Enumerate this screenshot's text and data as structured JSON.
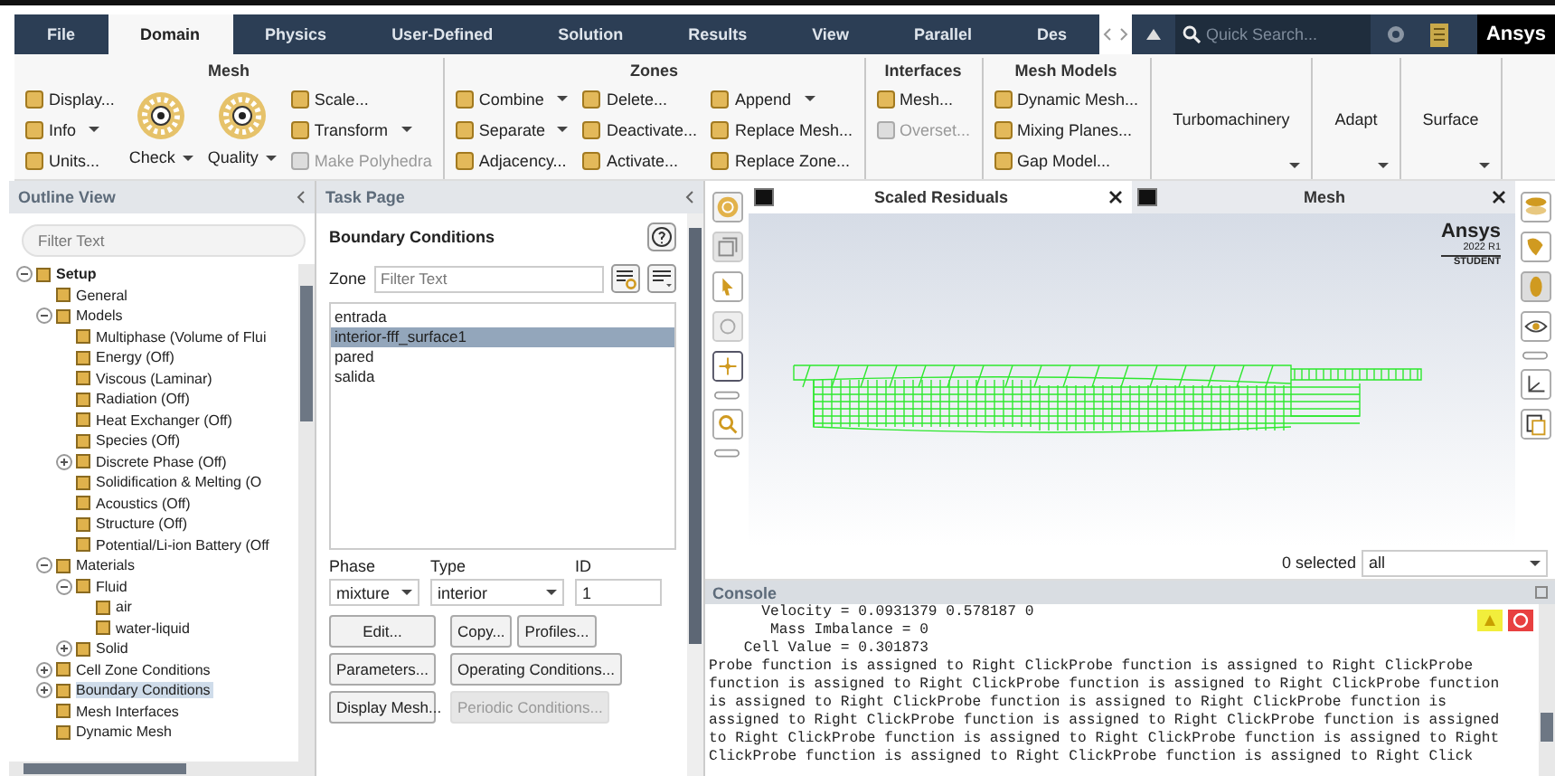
{
  "menu_tabs": [
    {
      "label": "File",
      "selected": false
    },
    {
      "label": "Domain",
      "selected": true
    },
    {
      "label": "Physics",
      "selected": false
    },
    {
      "label": "User-Defined",
      "selected": false
    },
    {
      "label": "Solution",
      "selected": false
    },
    {
      "label": "Results",
      "selected": false
    },
    {
      "label": "View",
      "selected": false
    },
    {
      "label": "Parallel",
      "selected": false
    },
    {
      "label": "Des",
      "selected": false
    }
  ],
  "search": {
    "placeholder": "Quick Search..."
  },
  "brand": "Ansys",
  "ribbon": [
    {
      "kind": "panel",
      "title": "Mesh",
      "columns": [
        [
          {
            "kind": "small",
            "label": "Display...",
            "dropdown": false,
            "disabled": false
          },
          {
            "kind": "small",
            "label": "Info",
            "dropdown": true,
            "disabled": false
          },
          {
            "kind": "small",
            "label": "Units...",
            "dropdown": false,
            "disabled": false
          }
        ],
        [
          {
            "kind": "large",
            "label": "Check",
            "dropdown": true,
            "disabled": false
          }
        ],
        [
          {
            "kind": "large",
            "label": "Quality",
            "dropdown": true,
            "disabled": false
          }
        ],
        [
          {
            "kind": "small",
            "label": "Scale...",
            "dropdown": false,
            "disabled": false
          },
          {
            "kind": "small",
            "label": "Transform",
            "dropdown": true,
            "disabled": false
          },
          {
            "kind": "small",
            "label": "Make Polyhedra",
            "dropdown": false,
            "disabled": true
          }
        ]
      ]
    },
    {
      "kind": "panel",
      "title": "Zones",
      "columns": [
        [
          {
            "kind": "small",
            "label": "Combine",
            "dropdown": true,
            "disabled": false
          },
          {
            "kind": "small",
            "label": "Separate",
            "dropdown": true,
            "disabled": false
          },
          {
            "kind": "small",
            "label": "Adjacency...",
            "dropdown": false,
            "disabled": false
          }
        ],
        [
          {
            "kind": "small",
            "label": "Delete...",
            "dropdown": false,
            "disabled": false
          },
          {
            "kind": "small",
            "label": "Deactivate...",
            "dropdown": false,
            "disabled": false
          },
          {
            "kind": "small",
            "label": "Activate...",
            "dropdown": false,
            "disabled": false
          }
        ],
        [
          {
            "kind": "small",
            "label": "Append",
            "dropdown": true,
            "disabled": false
          },
          {
            "kind": "small",
            "label": "Replace Mesh...",
            "dropdown": false,
            "disabled": false
          },
          {
            "kind": "small",
            "label": "Replace Zone...",
            "dropdown": false,
            "disabled": false
          }
        ]
      ]
    },
    {
      "kind": "panel",
      "title": "Interfaces",
      "columns": [
        [
          {
            "kind": "small",
            "label": "Mesh...",
            "dropdown": false,
            "disabled": false
          },
          {
            "kind": "small",
            "label": "Overset...",
            "dropdown": false,
            "disabled": true
          }
        ]
      ]
    },
    {
      "kind": "panel",
      "title": "Mesh Models",
      "columns": [
        [
          {
            "kind": "small",
            "label": "Dynamic Mesh...",
            "dropdown": false,
            "disabled": false
          },
          {
            "kind": "small",
            "label": "Mixing Planes...",
            "dropdown": false,
            "disabled": false
          },
          {
            "kind": "small",
            "label": "Gap Model...",
            "dropdown": false,
            "disabled": false
          }
        ]
      ]
    },
    {
      "kind": "menu",
      "label": "Turbomachinery"
    },
    {
      "kind": "menu",
      "label": "Adapt"
    },
    {
      "kind": "menu",
      "label": "Surface"
    }
  ],
  "outline": {
    "title": "Outline View",
    "filter": {
      "placeholder": "Filter Text"
    },
    "tree": [
      {
        "label": "Setup",
        "expanded": true,
        "selected": false,
        "children": [
          {
            "label": "General",
            "selected": false
          },
          {
            "label": "Models",
            "expanded": true,
            "selected": false,
            "children": [
              {
                "label": "Multiphase (Volume of Flui",
                "selected": false
              },
              {
                "label": "Energy (Off)",
                "selected": false
              },
              {
                "label": "Viscous (Laminar)",
                "selected": false
              },
              {
                "label": "Radiation (Off)",
                "selected": false
              },
              {
                "label": "Heat Exchanger (Off)",
                "selected": false
              },
              {
                "label": "Species (Off)",
                "selected": false
              },
              {
                "label": "Discrete Phase (Off)",
                "expanded": false,
                "selected": false
              },
              {
                "label": "Solidification & Melting (O",
                "selected": false
              },
              {
                "label": "Acoustics (Off)",
                "selected": false
              },
              {
                "label": "Structure (Off)",
                "selected": false
              },
              {
                "label": "Potential/Li-ion Battery (Off",
                "selected": false
              }
            ]
          },
          {
            "label": "Materials",
            "expanded": true,
            "selected": false,
            "children": [
              {
                "label": "Fluid",
                "expanded": true,
                "selected": false,
                "children": [
                  {
                    "label": "air",
                    "selected": false
                  },
                  {
                    "label": "water-liquid",
                    "selected": false
                  }
                ]
              },
              {
                "label": "Solid",
                "expanded": false,
                "selected": false
              }
            ]
          },
          {
            "label": "Cell Zone Conditions",
            "expanded": false,
            "selected": false
          },
          {
            "label": "Boundary Conditions",
            "expanded": false,
            "selected": true
          },
          {
            "label": "Mesh Interfaces",
            "selected": false
          },
          {
            "label": "Dynamic Mesh",
            "selected": false
          }
        ]
      }
    ]
  },
  "task_page": {
    "title": "Task Page",
    "heading": "Boundary Conditions",
    "zone_label": "Zone",
    "zone_filter": {
      "placeholder": "Filter Text"
    },
    "zones": [
      {
        "label": "entrada",
        "selected": false
      },
      {
        "label": "interior-fff_surface1",
        "selected": true
      },
      {
        "label": "pared",
        "selected": false
      },
      {
        "label": "salida",
        "selected": false
      }
    ],
    "phase": {
      "label": "Phase",
      "value": "mixture"
    },
    "type": {
      "label": "Type",
      "value": "interior"
    },
    "id": {
      "label": "ID",
      "value": "1"
    },
    "button_columns": [
      [
        [
          {
            "label": "Edit...",
            "disabled": false
          }
        ],
        [
          {
            "label": "Parameters...",
            "disabled": false
          }
        ],
        [
          {
            "label": "Display Mesh...",
            "disabled": false
          }
        ]
      ],
      [
        [
          {
            "label": "Copy...",
            "disabled": false
          },
          {
            "label": "Profiles...",
            "disabled": false
          }
        ],
        [
          {
            "label": "Operating Conditions...",
            "disabled": false
          }
        ],
        [
          {
            "label": "Periodic Conditions...",
            "disabled": true
          }
        ]
      ]
    ]
  },
  "graphics": {
    "tabs": [
      {
        "label": "Scaled Residuals",
        "selected": true
      },
      {
        "label": "Mesh",
        "selected": false
      }
    ],
    "logo": {
      "name": "Ansys",
      "version": "2022 R1",
      "edition": "STUDENT"
    },
    "selection": {
      "count": "0 selected",
      "filter": "all"
    }
  },
  "console": {
    "title": "Console",
    "lines": [
      "      Velocity = 0.0931379 0.578187 0",
      "       Mass Imbalance = 0",
      "    Cell Value = 0.301873",
      "Probe function is assigned to Right ClickProbe function is assigned to Right ClickProbe",
      "function is assigned to Right ClickProbe function is assigned to Right ClickProbe function",
      "is assigned to Right ClickProbe function is assigned to Right ClickProbe function is",
      "assigned to Right ClickProbe function is assigned to Right ClickProbe function is assigned",
      "to Right ClickProbe function is assigned to Right ClickProbe function is assigned to Right",
      "ClickProbe function is assigned to Right ClickProbe function is assigned to Right Click"
    ]
  }
}
